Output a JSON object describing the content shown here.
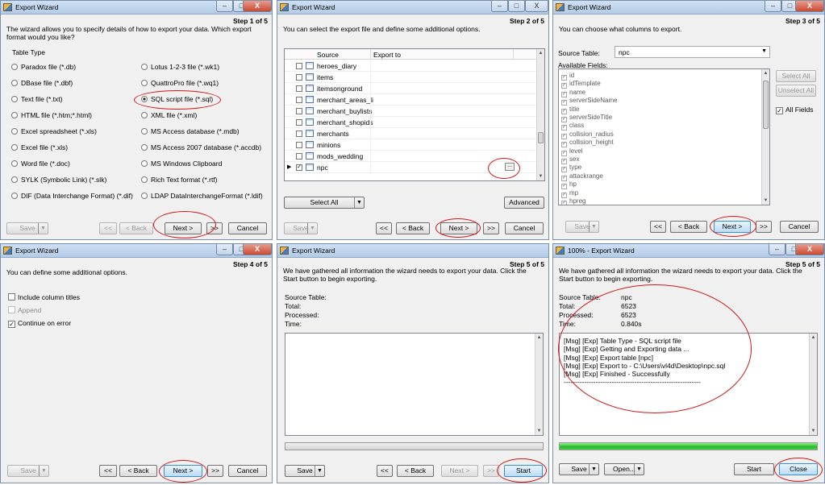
{
  "colors": {
    "annotation": "#d01818",
    "progress": "#2bc32b",
    "titlebar": "#b9cfe9",
    "close": "#c94a32"
  },
  "window_title": "Export Wizard",
  "window_title_p6": "100% - Export Wizard",
  "caption": {
    "min": "–",
    "max": "□",
    "close": "X"
  },
  "nav": {
    "first": "<<",
    "back": "< Back",
    "next": "Next >",
    "last": ">>",
    "cancel": "Cancel",
    "save": "Save",
    "start": "Start",
    "open": "Open...",
    "close": "Close"
  },
  "p1": {
    "step": "Step 1 of 5",
    "desc": "The wizard allows you to specify details of how to export your data. Which export format would you like?",
    "group": "Table Type",
    "left": [
      "Paradox file (*.db)",
      "DBase file (*.dbf)",
      "Text file (*.txt)",
      "HTML file (*.htm;*.html)",
      "Excel spreadsheet (*.xls)",
      "Excel file (*.xls)",
      "Word file (*.doc)",
      "SYLK (Symbolic Link) (*.slk)",
      "DIF (Data Interchange Format) (*.dif)"
    ],
    "right": [
      "Lotus 1-2-3 file (*.wk1)",
      "QuattroPro file (*.wq1)",
      "SQL script file (*.sql)",
      "XML file (*.xml)",
      "MS Access database (*.mdb)",
      "MS Access 2007 database (*.accdb)",
      "MS Windows Clipboard",
      "Rich Text format (*.rtf)",
      "LDAP DataInterchangeFormat (*.ldif)"
    ],
    "selected": "SQL script file (*.sql)"
  },
  "p2": {
    "step": "Step 2 of 5",
    "desc": "You can select the export file and define some additional options.",
    "col_source": "Source",
    "col_export": "Export to",
    "rows": [
      "heroes_diary",
      "items",
      "itemsonground",
      "merchant_areas_li",
      "merchant_buylists",
      "merchant_shopids",
      "merchants",
      "minions",
      "mods_wedding",
      "npc"
    ],
    "select_all": "Select All",
    "advanced": "Advanced",
    "ellipsis": "..."
  },
  "p3": {
    "step": "Step 3 of 5",
    "desc": "You can choose what columns to export.",
    "source_label": "Source Table:",
    "source_value": "npc",
    "fields_label": "Available Fields:",
    "fields": [
      "id",
      "idTemplate",
      "name",
      "serverSideName",
      "title",
      "serverSideTitle",
      "class",
      "collision_radius",
      "collision_height",
      "level",
      "sex",
      "type",
      "attackrange",
      "hp",
      "mp",
      "hpreg"
    ],
    "select_all": "Select All",
    "unselect_all": "Unselect All",
    "all_fields": "All Fields"
  },
  "p4": {
    "step": "Step 4 of 5",
    "desc": "You can define some additional options.",
    "opt1": "Include column titles",
    "opt2": "Append",
    "opt3": "Continue on error"
  },
  "p5": {
    "step": "Step 5 of 5",
    "desc": "We have gathered all information the wizard needs to export your data. Click the Start button to begin exporting.",
    "labels": [
      "Source Table:",
      "Total:",
      "Processed:",
      "Time:"
    ]
  },
  "p6": {
    "step": "Step 5 of 5",
    "desc": "We have gathered all information the wizard needs to export your data. Click the Start button to begin exporting.",
    "labels": [
      "Source Table:",
      "Total:",
      "Processed:",
      "Time:"
    ],
    "values": [
      "npc",
      "6523",
      "6523",
      "0.840s"
    ],
    "log": [
      "[Msg] [Exp] Table Type - SQL script file",
      "[Msg] [Exp] Getting and Exporting data ...",
      "[Msg] [Exp] Export table [npc]",
      "[Msg] [Exp] Export to - C:\\Users\\vl4d\\Desktop\\npc.sql",
      "[Msg] [Exp] Finished - Successfully",
      "------------------------------------------------------------"
    ],
    "progress": 1.0
  }
}
